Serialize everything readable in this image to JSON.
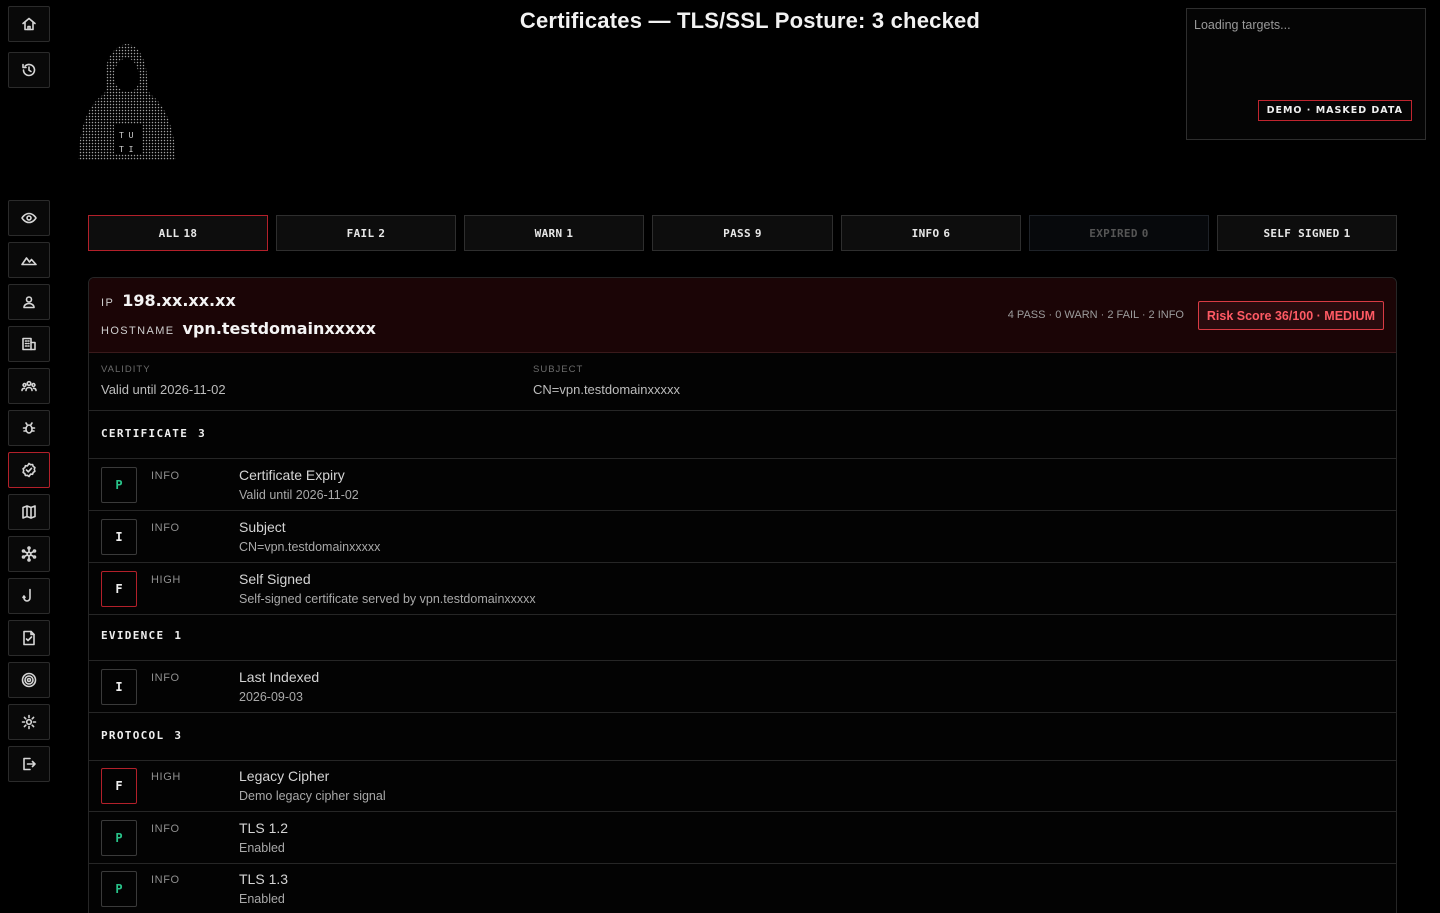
{
  "sidebar": {
    "items": [
      {
        "name": "home-icon",
        "active": false
      },
      {
        "name": "history-icon",
        "active": false
      },
      {
        "name": "eye-icon",
        "active": false
      },
      {
        "name": "terrain-icon",
        "active": false
      },
      {
        "name": "user-icon",
        "active": false
      },
      {
        "name": "building-icon",
        "active": false
      },
      {
        "name": "group-icon",
        "active": false
      },
      {
        "name": "bug-icon",
        "active": false
      },
      {
        "name": "certificate-icon",
        "active": true
      },
      {
        "name": "map-icon",
        "active": false
      },
      {
        "name": "network-icon",
        "active": false
      },
      {
        "name": "hook-icon",
        "active": false
      },
      {
        "name": "document-icon",
        "active": false
      },
      {
        "name": "target-icon",
        "active": false
      },
      {
        "name": "settings-icon",
        "active": false
      },
      {
        "name": "logout-icon",
        "active": false
      }
    ]
  },
  "logo": {
    "text_top": "T U",
    "text_bottom": "T I"
  },
  "page": {
    "title": "Certificates — TLS/SSL Posture: 3 checked"
  },
  "targets": {
    "loading": "Loading targets...",
    "demo_badge": "DEMO · MASKED DATA"
  },
  "filters": [
    {
      "label": "ALL",
      "count": "18",
      "active": true,
      "disabled": false
    },
    {
      "label": "FAIL",
      "count": "2",
      "active": false,
      "disabled": false
    },
    {
      "label": "WARN",
      "count": "1",
      "active": false,
      "disabled": false
    },
    {
      "label": "PASS",
      "count": "9",
      "active": false,
      "disabled": false
    },
    {
      "label": "INFO",
      "count": "6",
      "active": false,
      "disabled": false
    },
    {
      "label": "EXPIRED",
      "count": "0",
      "active": false,
      "disabled": true
    },
    {
      "label": "SELF SIGNED",
      "count": "1",
      "active": false,
      "disabled": false
    }
  ],
  "host": {
    "ip_label": "IP",
    "ip": "198.xx.xx.xx",
    "hostname_label": "HOSTNAME",
    "hostname": "vpn.testdomainxxxxx",
    "counts": "4 PASS · 0 WARN · 2 FAIL · 2 INFO",
    "risk": "Risk Score 36/100 · MEDIUM",
    "validity_label": "VALIDITY",
    "validity": "Valid until 2026-11-02",
    "subject_label": "SUBJECT",
    "subject": "CN=vpn.testdomainxxxxx"
  },
  "sections": [
    {
      "label": "CERTIFICATE",
      "count": "3",
      "checks": [
        {
          "badge": "P",
          "kind": "p",
          "severity": "INFO",
          "title": "Certificate Expiry",
          "detail": "Valid until 2026-11-02"
        },
        {
          "badge": "I",
          "kind": "i",
          "severity": "INFO",
          "title": "Subject",
          "detail": "CN=vpn.testdomainxxxxx"
        },
        {
          "badge": "F",
          "kind": "f",
          "severity": "HIGH",
          "title": "Self Signed",
          "detail": "Self-signed certificate served by vpn.testdomainxxxxx"
        }
      ]
    },
    {
      "label": "EVIDENCE",
      "count": "1",
      "checks": [
        {
          "badge": "I",
          "kind": "i",
          "severity": "INFO",
          "title": "Last Indexed",
          "detail": "2026-09-03"
        }
      ]
    },
    {
      "label": "PROTOCOL",
      "count": "3",
      "checks": [
        {
          "badge": "F",
          "kind": "f",
          "severity": "HIGH",
          "title": "Legacy Cipher",
          "detail": "Demo legacy cipher signal"
        },
        {
          "badge": "P",
          "kind": "p",
          "severity": "INFO",
          "title": "TLS 1.2",
          "detail": "Enabled"
        },
        {
          "badge": "P",
          "kind": "p",
          "severity": "INFO",
          "title": "TLS 1.3",
          "detail": "Enabled"
        }
      ]
    }
  ]
}
